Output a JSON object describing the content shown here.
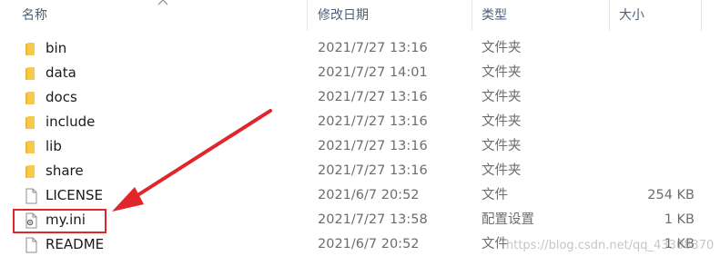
{
  "columns": {
    "name": "名称",
    "date": "修改日期",
    "type": "类型",
    "size": "大小"
  },
  "sort_icon": "^",
  "rows": [
    {
      "name": "bin",
      "date": "2021/7/27 13:16",
      "type": "文件夹",
      "size": "",
      "icon": "folder-icon"
    },
    {
      "name": "data",
      "date": "2021/7/27 14:01",
      "type": "文件夹",
      "size": "",
      "icon": "folder-icon"
    },
    {
      "name": "docs",
      "date": "2021/7/27 13:16",
      "type": "文件夹",
      "size": "",
      "icon": "folder-icon"
    },
    {
      "name": "include",
      "date": "2021/7/27 13:16",
      "type": "文件夹",
      "size": "",
      "icon": "folder-icon"
    },
    {
      "name": "lib",
      "date": "2021/7/27 13:16",
      "type": "文件夹",
      "size": "",
      "icon": "folder-icon"
    },
    {
      "name": "share",
      "date": "2021/7/27 13:16",
      "type": "文件夹",
      "size": "",
      "icon": "folder-icon"
    },
    {
      "name": "LICENSE",
      "date": "2021/6/7 20:52",
      "type": "文件",
      "size": "254 KB",
      "icon": "file-icon"
    },
    {
      "name": "my.ini",
      "date": "2021/7/27 13:58",
      "type": "配置设置",
      "size": "1 KB",
      "icon": "settings-file-icon"
    },
    {
      "name": "README",
      "date": "2021/6/7 20:52",
      "type": "文件",
      "size": "1 KB",
      "icon": "file-icon"
    }
  ],
  "watermark": "https://blog.csdn.net/qq_43308370",
  "colors": {
    "folder": "#f8c94b",
    "highlight": "#e0262a",
    "arrow": "#e0262a"
  }
}
